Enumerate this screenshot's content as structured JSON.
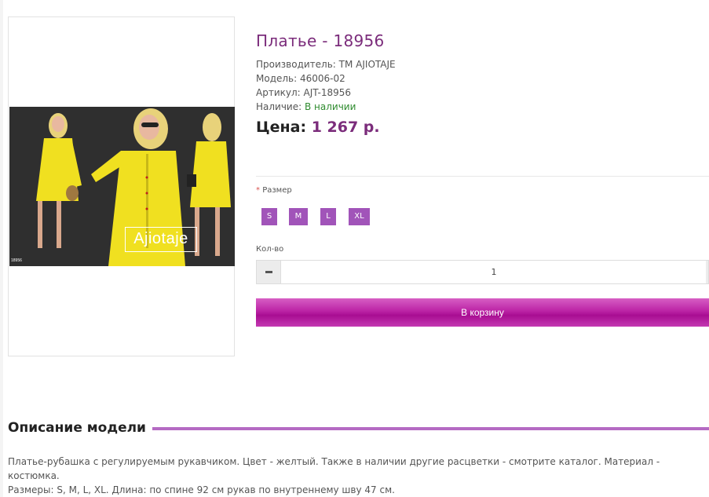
{
  "product": {
    "title": "Платье - 18956",
    "manufacturer_label": "Производитель:",
    "manufacturer_value": "ТМ AJIOTAJE",
    "model_label": "Модель:",
    "model_value": "46006-02",
    "sku_label": "Артикул:",
    "sku_value": "AJT-18956",
    "stock_label": "Наличие:",
    "stock_value": "В наличии",
    "price_label": "Цена:",
    "price_value": "1 267 р.",
    "image": {
      "watermark": "Ajiotaje",
      "code": "18956",
      "dress_color": "#f0e020",
      "background_color": "#2b2b2b"
    }
  },
  "options": {
    "size_required_mark": "*",
    "size_label": "Размер",
    "sizes": [
      "S",
      "M",
      "L",
      "XL"
    ],
    "qty_label": "Кол-во",
    "qty_value": "1"
  },
  "actions": {
    "cart_label": "В корзину"
  },
  "description": {
    "heading": "Описание модели",
    "line1": "Платье-рубашка с регулируемым рукавчиком. Цвет - желтый. Также в наличии другие расцветки - смотрите каталог. Материал - костюмка.",
    "line2": "Размеры: S, M, L, XL. Длина: по спине 92 см рукав по внутреннему шву 47 см."
  },
  "colors": {
    "accent": "#7b2c7b",
    "size_button": "#a154b9",
    "cart_button": "#bb23a5",
    "in_stock": "#2e8b2e"
  }
}
